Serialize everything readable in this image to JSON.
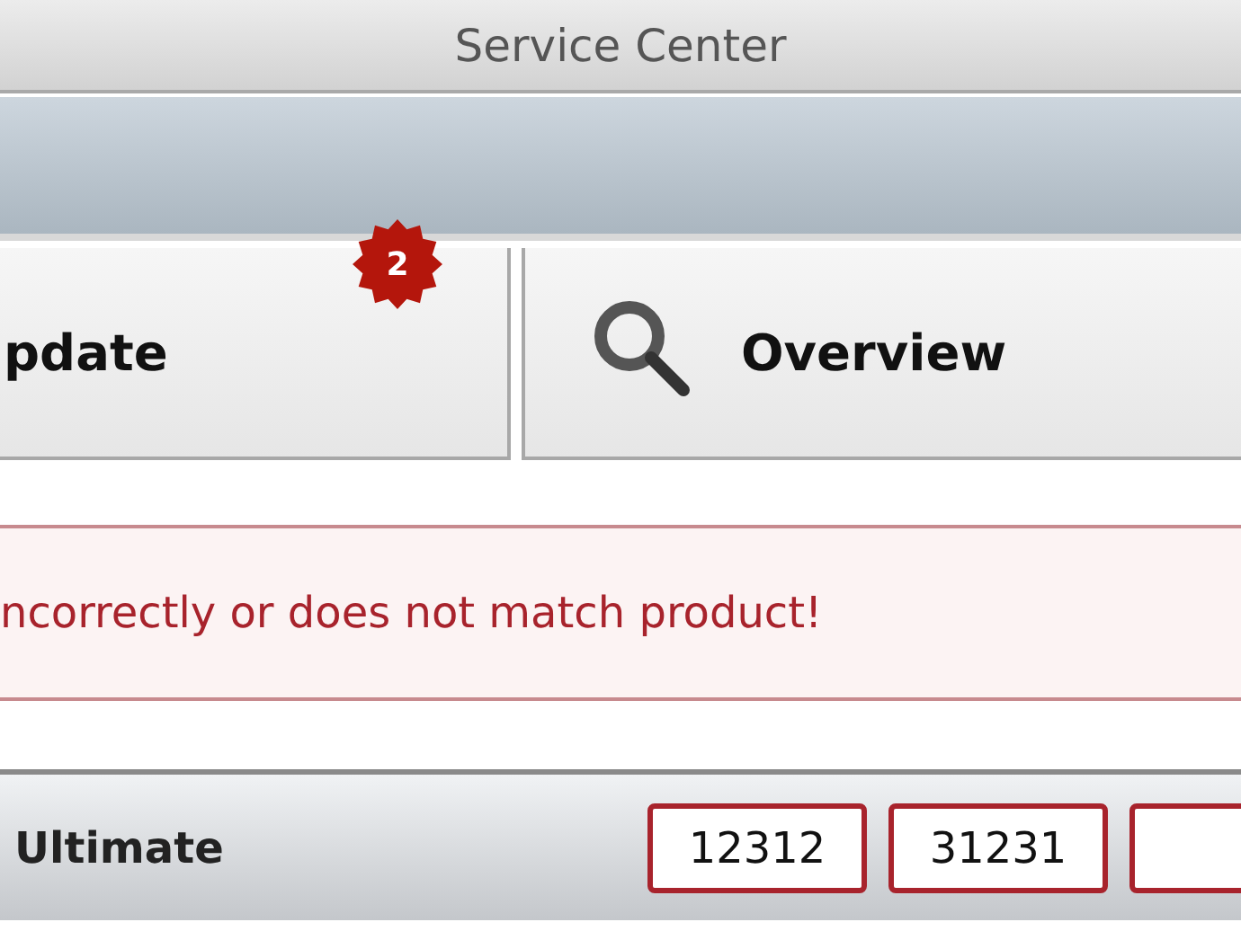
{
  "window": {
    "title": "Service Center"
  },
  "tabs": [
    {
      "label": "pdate",
      "badge": "2",
      "kind": "plain"
    },
    {
      "label": "Overview",
      "kind": "search"
    }
  ],
  "error": {
    "message": "ncorrectly or does not match product!"
  },
  "product": {
    "name": "Ultimate",
    "fields": [
      {
        "value": "12312"
      },
      {
        "value": "31231"
      }
    ]
  }
}
